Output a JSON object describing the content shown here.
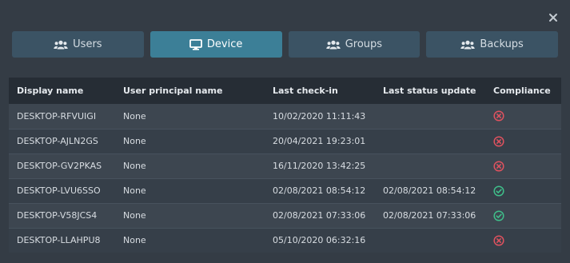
{
  "tabs": [
    {
      "label": "Users",
      "icon": "users-icon",
      "active": false
    },
    {
      "label": "Device",
      "icon": "monitor-icon",
      "active": true
    },
    {
      "label": "Groups",
      "icon": "users-icon",
      "active": false
    },
    {
      "label": "Backups",
      "icon": "users-icon",
      "active": false
    }
  ],
  "table": {
    "headers": [
      "Display name",
      "User principal name",
      "Last check-in",
      "Last status update",
      "Compliance"
    ],
    "rows": [
      {
        "display_name": "DESKTOP-RFVUIGI",
        "upn": "None",
        "last_checkin": "10/02/2020 11:11:43",
        "last_status": "",
        "compliance": "non-compliant"
      },
      {
        "display_name": "DESKTOP-AJLN2GS",
        "upn": "None",
        "last_checkin": "20/04/2021 19:23:01",
        "last_status": "",
        "compliance": "non-compliant"
      },
      {
        "display_name": "DESKTOP-GV2PKAS",
        "upn": "None",
        "last_checkin": "16/11/2020 13:42:25",
        "last_status": "",
        "compliance": "non-compliant"
      },
      {
        "display_name": "DESKTOP-LVU6SSO",
        "upn": "None",
        "last_checkin": "02/08/2021 08:54:12",
        "last_status": "02/08/2021 08:54:12",
        "compliance": "compliant"
      },
      {
        "display_name": "DESKTOP-V58JCS4",
        "upn": "None",
        "last_checkin": "02/08/2021 07:33:06",
        "last_status": "02/08/2021 07:33:06",
        "compliance": "compliant"
      },
      {
        "display_name": "DESKTOP-LLAHPU8",
        "upn": "None",
        "last_checkin": "05/10/2020 06:32:16",
        "last_status": "",
        "compliance": "non-compliant"
      }
    ]
  },
  "colors": {
    "compliant": "#3fbf8a",
    "non_compliant": "#e0525f",
    "active_tab": "#3c7f97",
    "tab": "#3b5364"
  }
}
